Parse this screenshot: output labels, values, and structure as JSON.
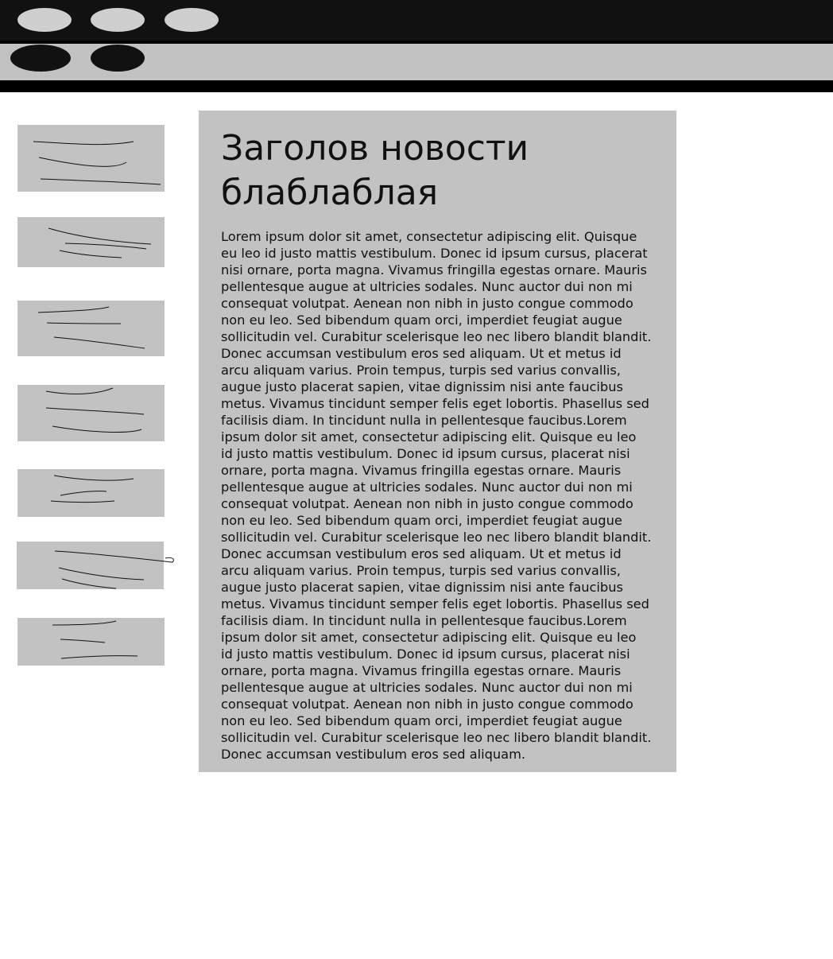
{
  "top_nav": {
    "buttons": [
      {
        "icon": "oval-button"
      },
      {
        "icon": "oval-button"
      },
      {
        "icon": "oval-button"
      }
    ]
  },
  "sub_nav": {
    "buttons": [
      {
        "icon": "oval-button"
      },
      {
        "icon": "oval-button"
      }
    ]
  },
  "sidebar": {
    "thumbnails": [
      {
        "content": "scribble-lines"
      },
      {
        "content": "scribble-lines"
      },
      {
        "content": "scribble-lines"
      },
      {
        "content": "scribble-lines"
      },
      {
        "content": "scribble-lines"
      },
      {
        "content": "scribble-lines"
      },
      {
        "content": "scribble-lines"
      }
    ]
  },
  "article": {
    "title": "Заголов новости блаблаблая",
    "body": "Lorem ipsum dolor sit amet, consectetur adipiscing elit. Quisque eu leo id justo mattis vestibulum. Donec id ipsum cursus, placerat nisi ornare, porta magna. Vivamus fringilla egestas ornare. Mauris pellentesque augue at ultricies sodales. Nunc auctor dui non mi consequat volutpat. Aenean non nibh in justo congue commodo non eu leo. Sed bibendum quam orci, imperdiet feugiat augue sollicitudin vel. Curabitur scelerisque leo nec libero blandit blandit. Donec accumsan vestibulum eros sed aliquam. Ut et metus id arcu aliquam varius. Proin tempus, turpis sed varius convallis, augue justo placerat sapien, vitae dignissim nisi ante faucibus metus. Vivamus tincidunt semper felis eget lobortis. Phasellus sed facilisis diam. In tincidunt nulla in pellentesque faucibus.Lorem ipsum dolor sit amet, consectetur adipiscing elit. Quisque eu leo id justo mattis vestibulum. Donec id ipsum cursus, placerat nisi ornare, porta magna. Vivamus fringilla egestas ornare. Mauris pellentesque augue at ultricies sodales. Nunc auctor dui non mi consequat volutpat. Aenean non nibh in justo congue commodo non eu leo. Sed bibendum quam orci, imperdiet feugiat augue sollicitudin vel. Curabitur scelerisque leo nec libero blandit blandit. Donec accumsan vestibulum eros sed aliquam. Ut et metus id arcu aliquam varius. Proin tempus, turpis sed varius convallis, augue justo placerat sapien, vitae dignissim nisi ante faucibus metus. Vivamus tincidunt semper felis eget lobortis. Phasellus sed facilisis diam. In tincidunt nulla in pellentesque faucibus.Lorem ipsum dolor sit amet, consectetur adipiscing elit. Quisque eu leo id justo mattis vestibulum. Donec id ipsum cursus, placerat nisi ornare, porta magna. Vivamus fringilla egestas ornare. Mauris pellentesque augue at ultricies sodales. Nunc auctor dui non mi consequat volutpat. Aenean non nibh in justo congue commodo non eu leo. Sed bibendum quam orci, imperdiet feugiat augue sollicitudin vel. Curabitur scelerisque leo nec libero blandit blandit. Donec accumsan vestibulum eros sed aliquam."
  },
  "colors": {
    "top_bar": "#111111",
    "sub_bar": "#c2c2c2",
    "panel": "#c2c2c2",
    "text": "#111111"
  }
}
